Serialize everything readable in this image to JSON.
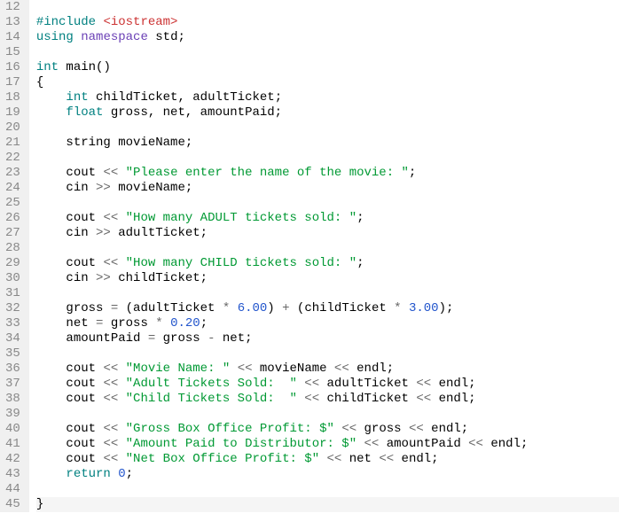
{
  "editor": {
    "first_line": 12,
    "highlight_line": 45,
    "lines": {
      "12": [],
      "13": [
        {
          "cls": "tok-pp",
          "t": "#include "
        },
        {
          "cls": "tok-inc",
          "t": "<iostream>"
        }
      ],
      "14": [
        {
          "cls": "tok-kw",
          "t": "using "
        },
        {
          "cls": "tok-ns",
          "t": "namespace"
        },
        {
          "cls": "tok-id",
          "t": " std"
        },
        {
          "cls": "tok-punct",
          "t": ";"
        }
      ],
      "15": [],
      "16": [
        {
          "cls": "tok-kw",
          "t": "int"
        },
        {
          "cls": "tok-id",
          "t": " main"
        },
        {
          "cls": "tok-punct",
          "t": "()"
        }
      ],
      "17": [
        {
          "cls": "tok-punct",
          "t": "{"
        }
      ],
      "18": [
        {
          "cls": "tok-id",
          "t": "    "
        },
        {
          "cls": "tok-kw",
          "t": "int"
        },
        {
          "cls": "tok-id",
          "t": " childTicket, adultTicket"
        },
        {
          "cls": "tok-punct",
          "t": ";"
        }
      ],
      "19": [
        {
          "cls": "tok-id",
          "t": "    "
        },
        {
          "cls": "tok-kw",
          "t": "float"
        },
        {
          "cls": "tok-id",
          "t": " gross, net, amountPaid"
        },
        {
          "cls": "tok-punct",
          "t": ";"
        }
      ],
      "20": [],
      "21": [
        {
          "cls": "tok-id",
          "t": "    string movieName"
        },
        {
          "cls": "tok-punct",
          "t": ";"
        }
      ],
      "22": [],
      "23": [
        {
          "cls": "tok-id",
          "t": "    cout "
        },
        {
          "cls": "tok-op",
          "t": "<< "
        },
        {
          "cls": "tok-str",
          "t": "\"Please enter the name of the movie: \""
        },
        {
          "cls": "tok-punct",
          "t": ";"
        }
      ],
      "24": [
        {
          "cls": "tok-id",
          "t": "    cin "
        },
        {
          "cls": "tok-op",
          "t": ">> "
        },
        {
          "cls": "tok-id",
          "t": "movieName"
        },
        {
          "cls": "tok-punct",
          "t": ";"
        }
      ],
      "25": [],
      "26": [
        {
          "cls": "tok-id",
          "t": "    cout "
        },
        {
          "cls": "tok-op",
          "t": "<< "
        },
        {
          "cls": "tok-str",
          "t": "\"How many ADULT tickets sold: \""
        },
        {
          "cls": "tok-punct",
          "t": ";"
        }
      ],
      "27": [
        {
          "cls": "tok-id",
          "t": "    cin "
        },
        {
          "cls": "tok-op",
          "t": ">> "
        },
        {
          "cls": "tok-id",
          "t": "adultTicket"
        },
        {
          "cls": "tok-punct",
          "t": ";"
        }
      ],
      "28": [],
      "29": [
        {
          "cls": "tok-id",
          "t": "    cout "
        },
        {
          "cls": "tok-op",
          "t": "<< "
        },
        {
          "cls": "tok-str",
          "t": "\"How many CHILD tickets sold: \""
        },
        {
          "cls": "tok-punct",
          "t": ";"
        }
      ],
      "30": [
        {
          "cls": "tok-id",
          "t": "    cin "
        },
        {
          "cls": "tok-op",
          "t": ">> "
        },
        {
          "cls": "tok-id",
          "t": "childTicket"
        },
        {
          "cls": "tok-punct",
          "t": ";"
        }
      ],
      "31": [],
      "32": [
        {
          "cls": "tok-id",
          "t": "    gross "
        },
        {
          "cls": "tok-op",
          "t": "= "
        },
        {
          "cls": "tok-punct",
          "t": "("
        },
        {
          "cls": "tok-id",
          "t": "adultTicket "
        },
        {
          "cls": "tok-op",
          "t": "* "
        },
        {
          "cls": "tok-num",
          "t": "6.00"
        },
        {
          "cls": "tok-punct",
          "t": ") "
        },
        {
          "cls": "tok-op",
          "t": "+ "
        },
        {
          "cls": "tok-punct",
          "t": "("
        },
        {
          "cls": "tok-id",
          "t": "childTicket "
        },
        {
          "cls": "tok-op",
          "t": "* "
        },
        {
          "cls": "tok-num",
          "t": "3.00"
        },
        {
          "cls": "tok-punct",
          "t": ");"
        }
      ],
      "33": [
        {
          "cls": "tok-id",
          "t": "    net "
        },
        {
          "cls": "tok-op",
          "t": "= "
        },
        {
          "cls": "tok-id",
          "t": "gross "
        },
        {
          "cls": "tok-op",
          "t": "* "
        },
        {
          "cls": "tok-num",
          "t": "0.20"
        },
        {
          "cls": "tok-punct",
          "t": ";"
        }
      ],
      "34": [
        {
          "cls": "tok-id",
          "t": "    amountPaid "
        },
        {
          "cls": "tok-op",
          "t": "= "
        },
        {
          "cls": "tok-id",
          "t": "gross "
        },
        {
          "cls": "tok-op",
          "t": "- "
        },
        {
          "cls": "tok-id",
          "t": "net"
        },
        {
          "cls": "tok-punct",
          "t": ";"
        }
      ],
      "35": [],
      "36": [
        {
          "cls": "tok-id",
          "t": "    cout "
        },
        {
          "cls": "tok-op",
          "t": "<< "
        },
        {
          "cls": "tok-str",
          "t": "\"Movie Name: \""
        },
        {
          "cls": "tok-id",
          "t": " "
        },
        {
          "cls": "tok-op",
          "t": "<< "
        },
        {
          "cls": "tok-id",
          "t": "movieName "
        },
        {
          "cls": "tok-op",
          "t": "<< "
        },
        {
          "cls": "tok-id",
          "t": "endl"
        },
        {
          "cls": "tok-punct",
          "t": ";"
        }
      ],
      "37": [
        {
          "cls": "tok-id",
          "t": "    cout "
        },
        {
          "cls": "tok-op",
          "t": "<< "
        },
        {
          "cls": "tok-str",
          "t": "\"Adult Tickets Sold:  \""
        },
        {
          "cls": "tok-id",
          "t": " "
        },
        {
          "cls": "tok-op",
          "t": "<< "
        },
        {
          "cls": "tok-id",
          "t": "adultTicket "
        },
        {
          "cls": "tok-op",
          "t": "<< "
        },
        {
          "cls": "tok-id",
          "t": "endl"
        },
        {
          "cls": "tok-punct",
          "t": ";"
        }
      ],
      "38": [
        {
          "cls": "tok-id",
          "t": "    cout "
        },
        {
          "cls": "tok-op",
          "t": "<< "
        },
        {
          "cls": "tok-str",
          "t": "\"Child Tickets Sold:  \""
        },
        {
          "cls": "tok-id",
          "t": " "
        },
        {
          "cls": "tok-op",
          "t": "<< "
        },
        {
          "cls": "tok-id",
          "t": "childTicket "
        },
        {
          "cls": "tok-op",
          "t": "<< "
        },
        {
          "cls": "tok-id",
          "t": "endl"
        },
        {
          "cls": "tok-punct",
          "t": ";"
        }
      ],
      "39": [],
      "40": [
        {
          "cls": "tok-id",
          "t": "    cout "
        },
        {
          "cls": "tok-op",
          "t": "<< "
        },
        {
          "cls": "tok-str",
          "t": "\"Gross Box Office Profit: $\""
        },
        {
          "cls": "tok-id",
          "t": " "
        },
        {
          "cls": "tok-op",
          "t": "<< "
        },
        {
          "cls": "tok-id",
          "t": "gross "
        },
        {
          "cls": "tok-op",
          "t": "<< "
        },
        {
          "cls": "tok-id",
          "t": "endl"
        },
        {
          "cls": "tok-punct",
          "t": ";"
        }
      ],
      "41": [
        {
          "cls": "tok-id",
          "t": "    cout "
        },
        {
          "cls": "tok-op",
          "t": "<< "
        },
        {
          "cls": "tok-str",
          "t": "\"Amount Paid to Distributor: $\""
        },
        {
          "cls": "tok-id",
          "t": " "
        },
        {
          "cls": "tok-op",
          "t": "<< "
        },
        {
          "cls": "tok-id",
          "t": "amountPaid "
        },
        {
          "cls": "tok-op",
          "t": "<< "
        },
        {
          "cls": "tok-id",
          "t": "endl"
        },
        {
          "cls": "tok-punct",
          "t": ";"
        }
      ],
      "42": [
        {
          "cls": "tok-id",
          "t": "    cout "
        },
        {
          "cls": "tok-op",
          "t": "<< "
        },
        {
          "cls": "tok-str",
          "t": "\"Net Box Office Profit: $\""
        },
        {
          "cls": "tok-id",
          "t": " "
        },
        {
          "cls": "tok-op",
          "t": "<< "
        },
        {
          "cls": "tok-id",
          "t": "net "
        },
        {
          "cls": "tok-op",
          "t": "<< "
        },
        {
          "cls": "tok-id",
          "t": "endl"
        },
        {
          "cls": "tok-punct",
          "t": ";"
        }
      ],
      "43": [
        {
          "cls": "tok-id",
          "t": "    "
        },
        {
          "cls": "tok-kw",
          "t": "return "
        },
        {
          "cls": "tok-num",
          "t": "0"
        },
        {
          "cls": "tok-punct",
          "t": ";"
        }
      ],
      "44": [],
      "45": [
        {
          "cls": "tok-punct",
          "t": "}"
        }
      ]
    }
  }
}
